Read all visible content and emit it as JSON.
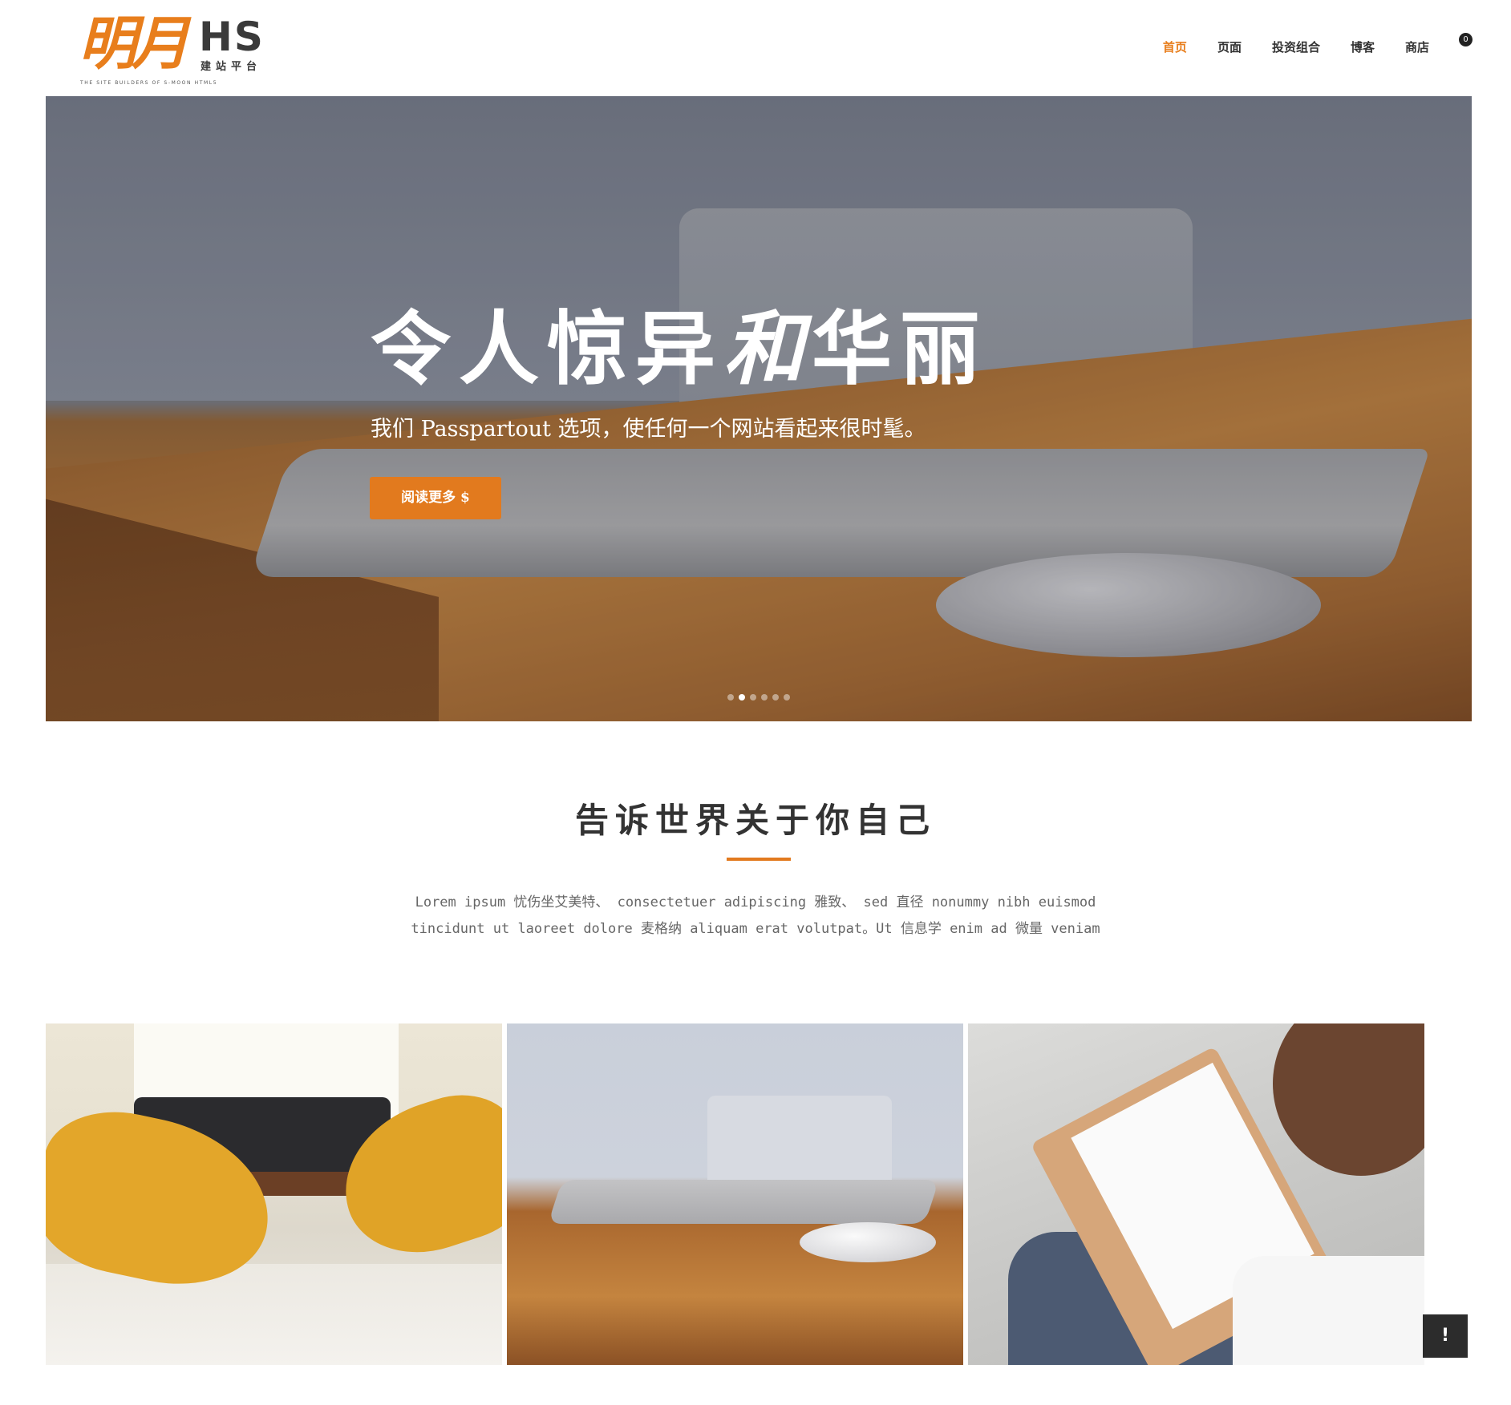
{
  "logo": {
    "brush_text": "明月",
    "hs_text": "HS",
    "sub_text": "建站平台",
    "tagline": "THE SITE BUILDERS OF S-MOON HTML5"
  },
  "nav": {
    "items": [
      {
        "label": "首页",
        "active": true
      },
      {
        "label": "页面",
        "active": false
      },
      {
        "label": "投资组合",
        "active": false
      },
      {
        "label": "博客",
        "active": false
      },
      {
        "label": "商店",
        "active": false
      }
    ],
    "cart_count": "0"
  },
  "hero": {
    "title_part1": "令人惊异",
    "title_part2": "和",
    "title_part3": "华丽",
    "subtitle": "我们 Passpartout 选项，使任何一个网站看起来很时髦。",
    "button_label": "阅读更多 $",
    "slider_dots": 6,
    "active_dot": 2
  },
  "about": {
    "title": "告诉世界关于你自己",
    "text": "Lorem ipsum 忧伤坐艾美特、 consectetuer adipiscing 雅致、 sed 直径 nonummy nibh euismod tincidunt ut laoreet dolore 麦格纳 aliquam erat volutpat。Ut 信息学 enim ad 微量 veniam"
  },
  "gallery": [
    {
      "image": "lounge-yellow-chairs"
    },
    {
      "image": "laptop-glasses-mouse"
    },
    {
      "image": "person-sketching"
    }
  ],
  "floating_button_label": "!",
  "colors": {
    "accent": "#e27a1e",
    "nav_active": "#e87e1c",
    "text_dark": "#333333",
    "text_muted": "#666666"
  }
}
